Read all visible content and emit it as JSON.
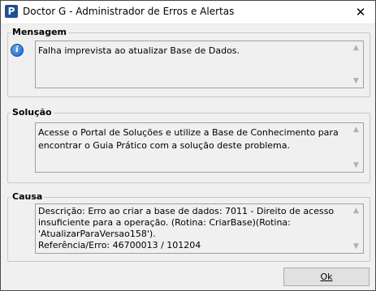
{
  "window": {
    "title": "Doctor G - Administrador de Erros e Alertas",
    "app_icon_letter": "P",
    "close_glyph": "✕"
  },
  "mensagem": {
    "label": "Mensagem",
    "text": "Falha imprevista ao atualizar Base de Dados.",
    "icon": "info-icon"
  },
  "solucao": {
    "label": "Solução",
    "text": "Acesse o Portal de Soluções e utilize a Base de Conhecimento para encontrar o Guia Prático com a solução deste problema."
  },
  "causa": {
    "label": "Causa",
    "text": "Descrição: Erro ao criar a base de dados: 7011 - Direito de acesso insuficiente para a operação. (Rotina: CriarBase)(Rotina: 'AtualizarParaVersao158').\nReferência/Erro: 46700013 / 101204"
  },
  "buttons": {
    "ok_label": "Ok"
  },
  "scroll_glyphs": {
    "up": "▲",
    "down": "▼"
  }
}
